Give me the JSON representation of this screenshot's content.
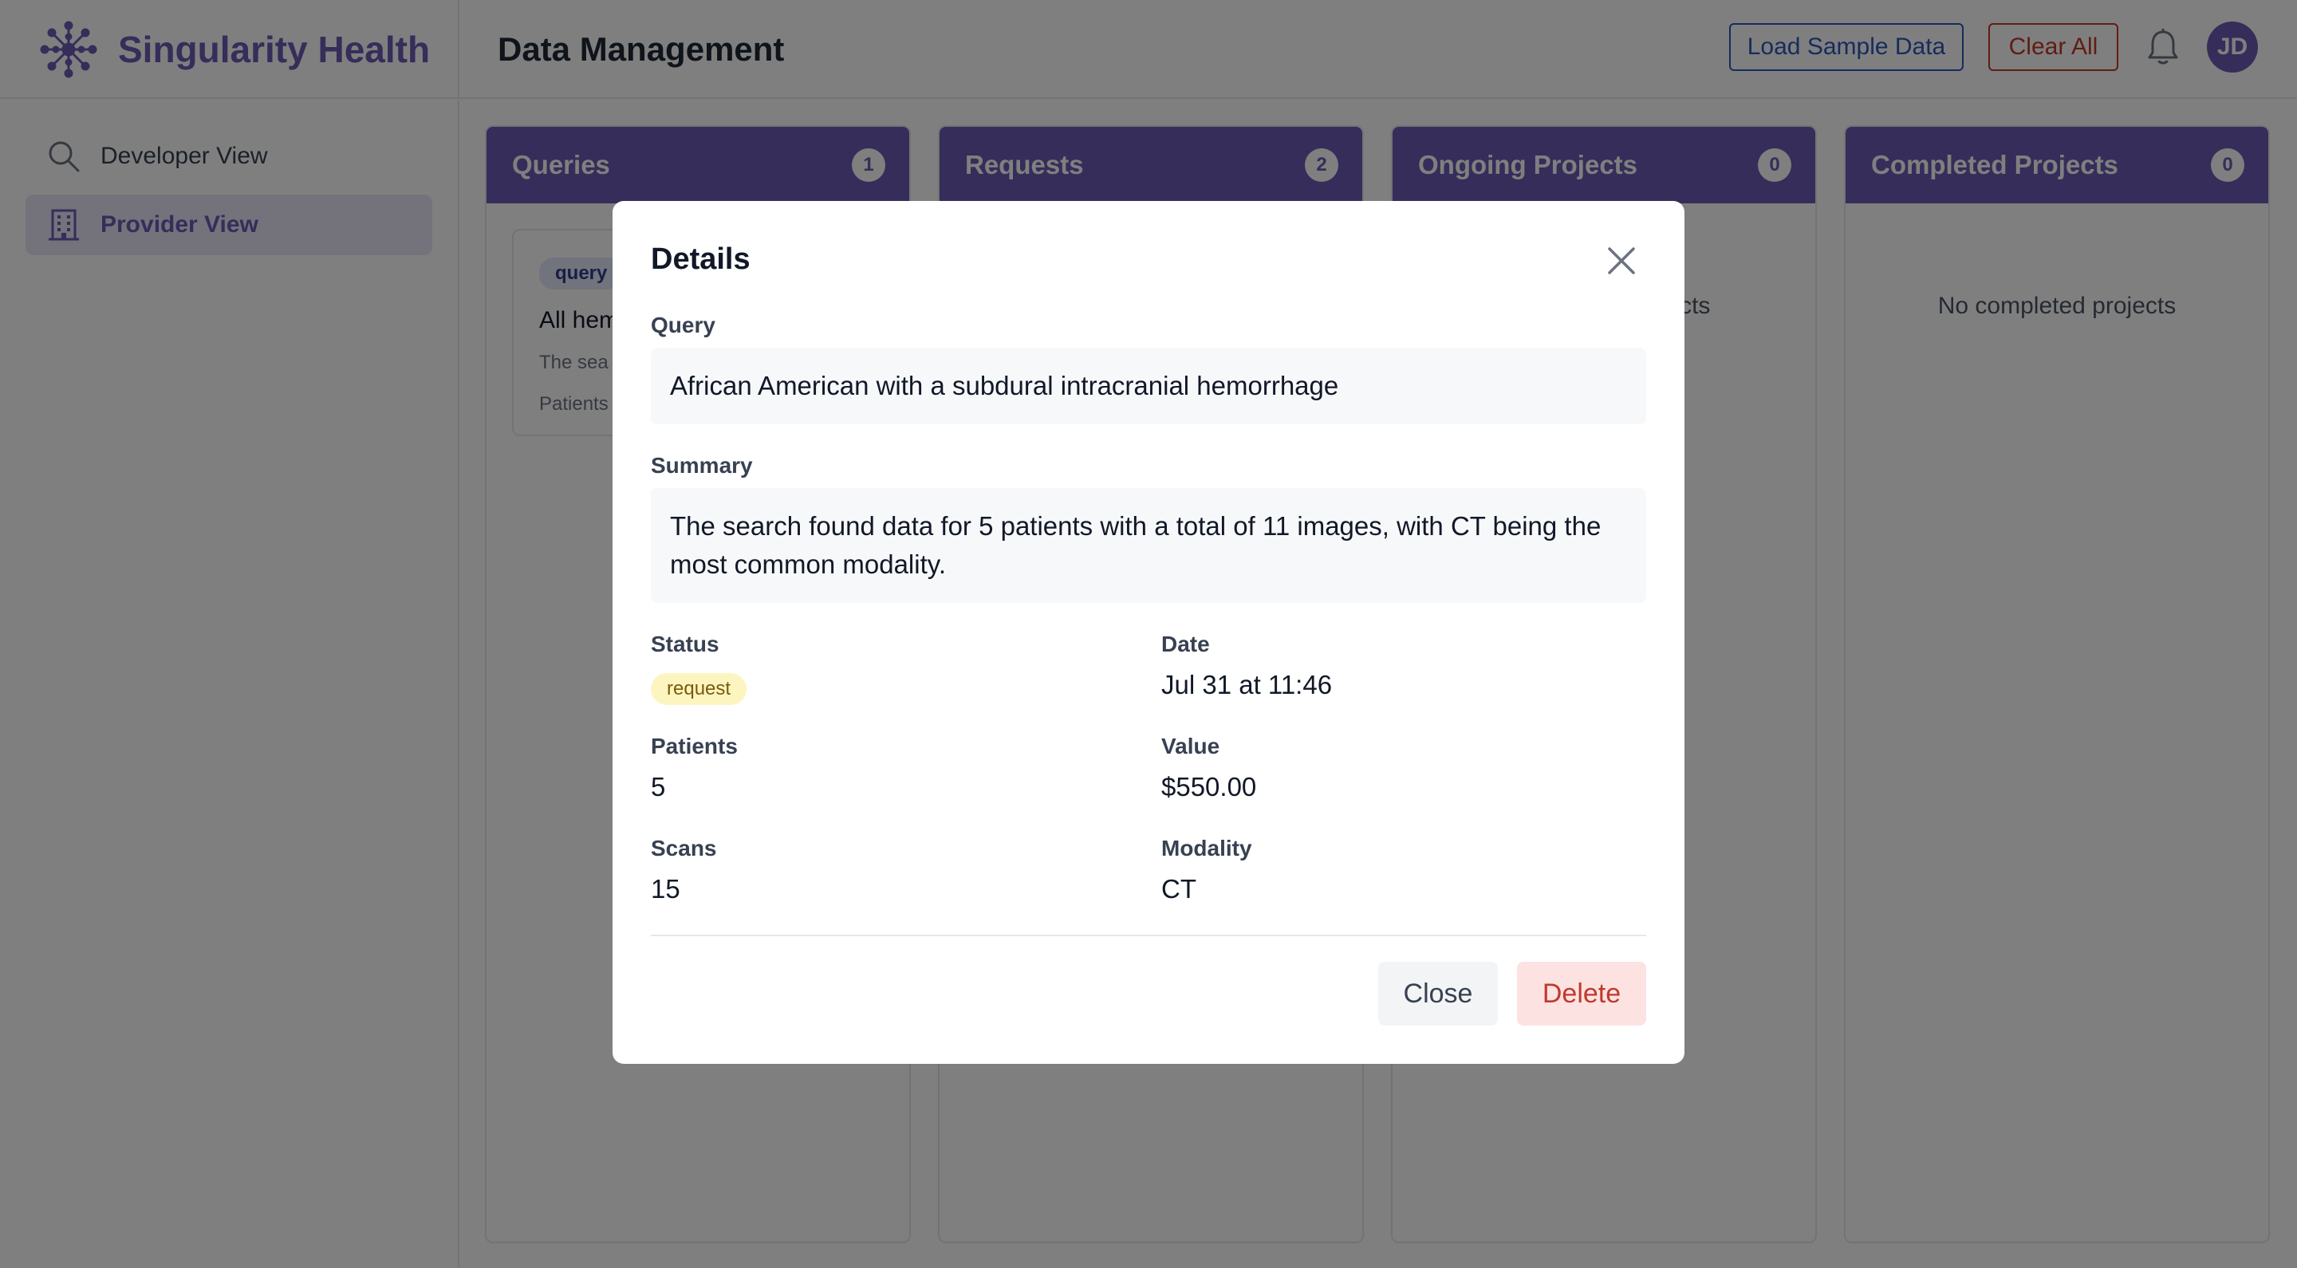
{
  "brand": {
    "name": "Singularity Health",
    "color": "#6d5bb5"
  },
  "header": {
    "title": "Data Management",
    "load_label": "Load Sample Data",
    "clear_label": "Clear All",
    "avatar_initials": "JD"
  },
  "sidebar": {
    "items": [
      {
        "label": "Developer View",
        "icon": "search-icon",
        "active": false
      },
      {
        "label": "Provider View",
        "icon": "building-icon",
        "active": true
      }
    ]
  },
  "columns": [
    {
      "title": "Queries",
      "count": "1",
      "empty": ""
    },
    {
      "title": "Requests",
      "count": "2",
      "empty": ""
    },
    {
      "title": "Ongoing Projects",
      "count": "0",
      "empty": "No ongoing projects"
    },
    {
      "title": "Completed Projects",
      "count": "0",
      "empty": "No completed projects"
    }
  ],
  "query_card": {
    "badge": "query",
    "title": "All hem",
    "text": "The sea",
    "meta": "Patients"
  },
  "modal": {
    "title": "Details",
    "query_label": "Query",
    "query_value": "African American with a subdural intracranial hemorrhage",
    "summary_label": "Summary",
    "summary_value": "The search found data for 5 patients with a total of 11 images, with CT being the most common modality.",
    "status_label": "Status",
    "status_value": "request",
    "date_label": "Date",
    "date_value": "Jul 31 at 11:46",
    "patients_label": "Patients",
    "patients_value": "5",
    "value_label": "Value",
    "value_value": "$550.00",
    "scans_label": "Scans",
    "scans_value": "15",
    "modality_label": "Modality",
    "modality_value": "CT",
    "close_label": "Close",
    "delete_label": "Delete"
  }
}
